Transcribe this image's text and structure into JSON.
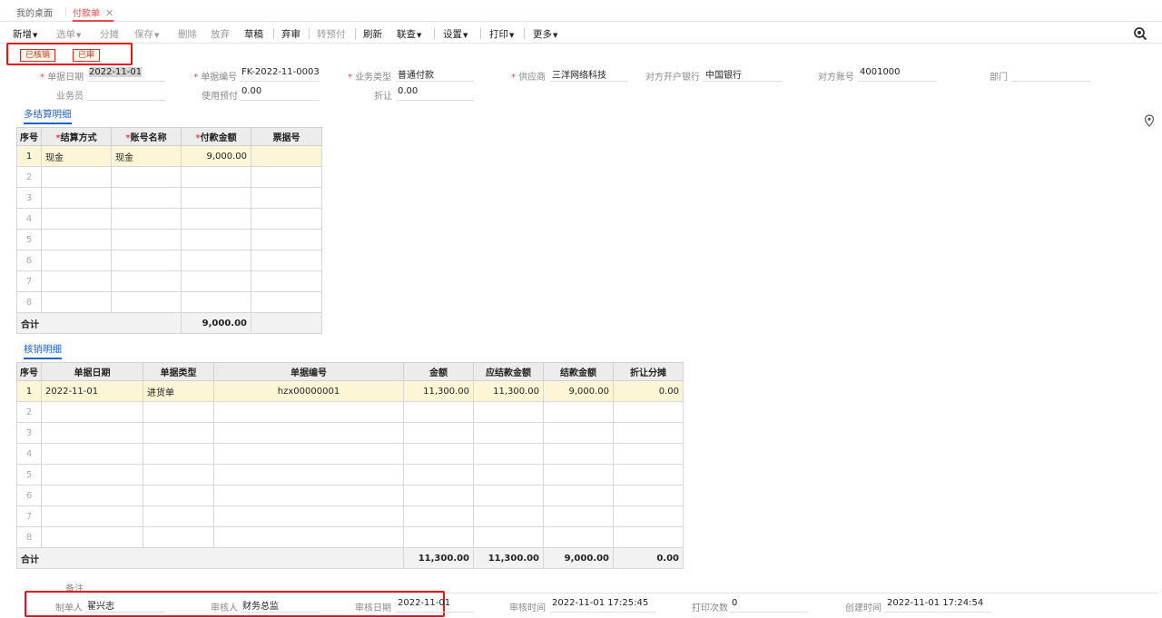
{
  "tabs": {
    "home": "我的桌面",
    "active": "付款单",
    "close": "✕"
  },
  "toolbar": {
    "items": [
      "新增",
      "选单",
      "分摊",
      "保存",
      "删除",
      "放弃",
      "草稿",
      "弃审",
      "转预付",
      "刷新",
      "联查",
      "设置",
      "打印",
      "更多"
    ]
  },
  "status": {
    "verified": "已核销",
    "audited": "已审"
  },
  "header": {
    "doc_date_label": "单据日期",
    "doc_date": "2022-11-01",
    "doc_no_label": "单据编号",
    "doc_no": "FK-2022-11-0003",
    "biz_type_label": "业务类型",
    "biz_type": "普通付款",
    "supplier_label": "供应商",
    "supplier": "三洋网络科技",
    "bank_label": "对方开户银行",
    "bank": "中国银行",
    "account_label": "对方账号",
    "account": "4001000",
    "dept_label": "部门",
    "dept": "",
    "clerk_label": "业务员",
    "clerk": "",
    "prepay_label": "使用预付",
    "prepay": "0.00",
    "discount_label": "折让",
    "discount": "0.00"
  },
  "settlement": {
    "title": "多结算明细",
    "columns": [
      "序号",
      "结算方式",
      "账号名称",
      "付款金额",
      "票据号"
    ],
    "rows": [
      {
        "idx": "1",
        "method": "现金",
        "account": "现金",
        "amount": "9,000.00",
        "ticket": ""
      }
    ],
    "empty_rows": [
      "2",
      "3",
      "4",
      "5",
      "6",
      "7",
      "8"
    ],
    "total_label": "合计",
    "total_amount": "9,000.00"
  },
  "writeoff": {
    "title": "核销明细",
    "columns": [
      "序号",
      "单据日期",
      "单据类型",
      "单据编号",
      "金额",
      "应结款金额",
      "结款金额",
      "折让分摊"
    ],
    "rows": [
      {
        "idx": "1",
        "date": "2022-11-01",
        "type": "进货单",
        "no": "hzx00000001",
        "amount": "11,300.00",
        "due": "11,300.00",
        "paid": "9,000.00",
        "disc": "0.00"
      }
    ],
    "empty_rows": [
      "2",
      "3",
      "4",
      "5",
      "6",
      "7",
      "8"
    ],
    "total_label": "合计",
    "total_amount": "11,300.00",
    "total_due": "11,300.00",
    "total_paid": "9,000.00",
    "total_disc": "0.00"
  },
  "footer": {
    "remark_label": "备注",
    "maker_label": "制单人",
    "maker": "翟兴志",
    "auditor_label": "审核人",
    "auditor": "财务总监",
    "audit_date_label": "审核日期",
    "audit_date": "2022-11-01",
    "audit_time_label": "审核时间",
    "audit_time": "2022-11-01 17:25:45",
    "print_count_label": "打印次数",
    "print_count": "0",
    "create_time_label": "创建时间",
    "create_time": "2022-11-01 17:24:54"
  },
  "colors": {
    "accent": "#1e64c8",
    "active_tab": "#e24a4a",
    "annotation_frame": "#e8141d",
    "selected_row": "#fdf6d6"
  }
}
